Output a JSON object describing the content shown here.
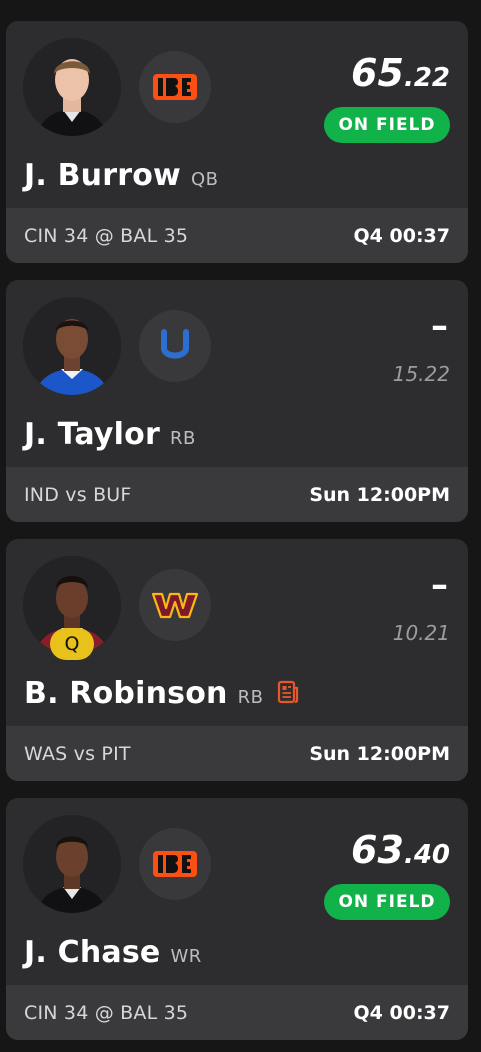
{
  "players": [
    {
      "name": "J. Burrow",
      "position": "QB",
      "team_logo": "bengals-logo",
      "score_whole": "65",
      "score_decimal": ".22",
      "status": "ON FIELD",
      "matchup": "CIN 34 @ BAL 35",
      "game_time": "Q4 00:37"
    },
    {
      "name": "J. Taylor",
      "position": "RB",
      "team_logo": "colts-logo",
      "score_placeholder": "–",
      "projection": "15.22",
      "matchup": "IND vs BUF",
      "game_time": "Sun 12:00PM"
    },
    {
      "name": "B. Robinson",
      "position": "RB",
      "team_logo": "commanders-logo",
      "injury_status": "Q",
      "news_icon": "news-icon",
      "score_placeholder": "–",
      "projection": "10.21",
      "matchup": "WAS vs PIT",
      "game_time": "Sun 12:00PM"
    },
    {
      "name": "J. Chase",
      "position": "WR",
      "team_logo": "bengals-logo",
      "score_whole": "63",
      "score_decimal": ".40",
      "status": "ON FIELD",
      "matchup": "CIN 34 @ BAL 35",
      "game_time": "Q4 00:37"
    }
  ],
  "colors": {
    "background": "#161616",
    "card": "#2d2d2f",
    "footer": "#3a3a3c",
    "on_field": "#12b24b",
    "injury_badge": "#e8c21a",
    "news_icon": "#e8572a",
    "bengals_orange": "#fb4f14",
    "colts_blue": "#003a70",
    "commanders_burgundy": "#7a1a2a",
    "commanders_gold": "#ffb612"
  }
}
